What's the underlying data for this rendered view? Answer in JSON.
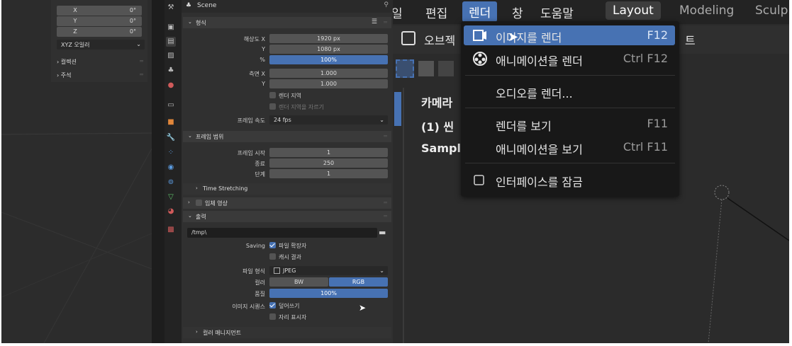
{
  "rotation": {
    "axes": [
      {
        "axis": "X",
        "value": "0°"
      },
      {
        "axis": "Y",
        "value": "0°"
      },
      {
        "axis": "Z",
        "value": "0°"
      }
    ],
    "mode": "XYZ 오일러",
    "collection_label": "컬렉션",
    "annotation_label": "주석"
  },
  "properties": {
    "header_title": "Scene",
    "format": {
      "title": "형식",
      "res_x_label": "해상도 X",
      "res_x": "1920 px",
      "res_y_label": "Y",
      "res_y": "1080 px",
      "percent_label": "%",
      "percent": "100%",
      "aspect_x_label": "측면 X",
      "aspect_x": "1.000",
      "aspect_y_label": "Y",
      "aspect_y": "1.000",
      "render_region": "렌더 지역",
      "crop_region": "렌더 지역을 자르기",
      "fps_label": "프레임 속도",
      "fps": "24 fps"
    },
    "frame_range": {
      "title": "프레임 범위",
      "start_label": "프레임 시작",
      "start": "1",
      "end_label": "종료",
      "end": "250",
      "step_label": "단계",
      "step": "1",
      "time_stretching": "Time Stretching"
    },
    "stereoscopy": {
      "title": "입체 영상"
    },
    "output": {
      "title": "출력",
      "path": "/tmp\\",
      "saving_label": "Saving",
      "file_extensions": "파일 확장자",
      "cache_result": "캐시 결과",
      "file_format_label": "파일 형식",
      "file_format": "JPEG",
      "color_label": "컬러",
      "color_bw": "BW",
      "color_rgb": "RGB",
      "quality_label": "품질",
      "quality": "100%",
      "image_sequence_label": "이미지 시퀀스",
      "overwrite": "덮어쓰기",
      "placeholders": "자리 표시자",
      "color_management": "컬러 매니지먼트"
    }
  },
  "topbar": {
    "menus": [
      "일",
      "편집",
      "렌더",
      "창",
      "도움말"
    ],
    "active_menu": "렌더",
    "workspaces": [
      "Layout",
      "Modeling",
      "Sculp"
    ],
    "active_workspace": "Layout"
  },
  "toolbar2": {
    "object_label": "오브젝",
    "extra_label": "트"
  },
  "viewport_text": {
    "line1": "카메라",
    "line2": "(1) 씬",
    "line3": "Sampl"
  },
  "render_menu": {
    "items": [
      {
        "label": "이미지를 렌더",
        "shortcut": "F12",
        "icon": "render-image-icon",
        "highlighted": true
      },
      {
        "label": "애니메이션을 렌더",
        "shortcut": "Ctrl F12",
        "icon": "render-animation-icon"
      },
      {
        "label": "오디오를 렌더...",
        "shortcut": ""
      },
      {
        "label": "렌더를 보기",
        "shortcut": "F11"
      },
      {
        "label": "애니메이션을 보기",
        "shortcut": "Ctrl F11"
      },
      {
        "label": "인터페이스를 잠금",
        "shortcut": "",
        "icon": "checkbox-icon"
      }
    ]
  }
}
